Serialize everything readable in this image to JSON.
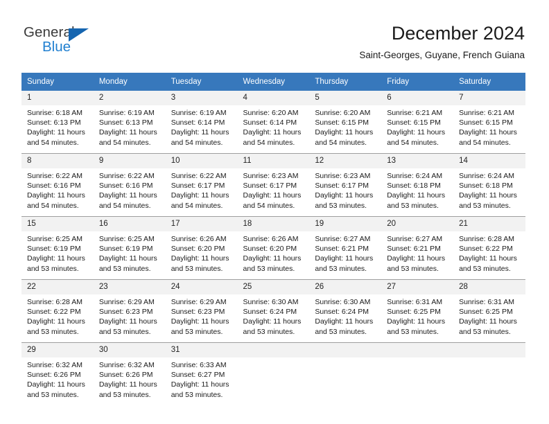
{
  "brand": {
    "name_top": "General",
    "name_bottom": "Blue",
    "triangle_color": "#1565b0",
    "blue_color": "#1f7fd0"
  },
  "header": {
    "title": "December 2024",
    "subtitle": "Saint-Georges, Guyane, French Guiana"
  },
  "theme": {
    "header_blue": "#3778bc",
    "daynum_band": "#f2f2f2",
    "row_border": "#9e9e9e"
  },
  "weekday_headers": [
    "Sunday",
    "Monday",
    "Tuesday",
    "Wednesday",
    "Thursday",
    "Friday",
    "Saturday"
  ],
  "labels": {
    "sunrise_prefix": "Sunrise:",
    "sunset_prefix": "Sunset:",
    "daylight_prefix": "Daylight:"
  },
  "weeks": [
    {
      "days": [
        {
          "date": "1",
          "sunrise": "Sunrise: 6:18 AM",
          "sunset": "Sunset: 6:13 PM",
          "daylight_l1": "Daylight: 11 hours",
          "daylight_l2": "and 54 minutes."
        },
        {
          "date": "2",
          "sunrise": "Sunrise: 6:19 AM",
          "sunset": "Sunset: 6:13 PM",
          "daylight_l1": "Daylight: 11 hours",
          "daylight_l2": "and 54 minutes."
        },
        {
          "date": "3",
          "sunrise": "Sunrise: 6:19 AM",
          "sunset": "Sunset: 6:14 PM",
          "daylight_l1": "Daylight: 11 hours",
          "daylight_l2": "and 54 minutes."
        },
        {
          "date": "4",
          "sunrise": "Sunrise: 6:20 AM",
          "sunset": "Sunset: 6:14 PM",
          "daylight_l1": "Daylight: 11 hours",
          "daylight_l2": "and 54 minutes."
        },
        {
          "date": "5",
          "sunrise": "Sunrise: 6:20 AM",
          "sunset": "Sunset: 6:15 PM",
          "daylight_l1": "Daylight: 11 hours",
          "daylight_l2": "and 54 minutes."
        },
        {
          "date": "6",
          "sunrise": "Sunrise: 6:21 AM",
          "sunset": "Sunset: 6:15 PM",
          "daylight_l1": "Daylight: 11 hours",
          "daylight_l2": "and 54 minutes."
        },
        {
          "date": "7",
          "sunrise": "Sunrise: 6:21 AM",
          "sunset": "Sunset: 6:15 PM",
          "daylight_l1": "Daylight: 11 hours",
          "daylight_l2": "and 54 minutes."
        }
      ]
    },
    {
      "days": [
        {
          "date": "8",
          "sunrise": "Sunrise: 6:22 AM",
          "sunset": "Sunset: 6:16 PM",
          "daylight_l1": "Daylight: 11 hours",
          "daylight_l2": "and 54 minutes."
        },
        {
          "date": "9",
          "sunrise": "Sunrise: 6:22 AM",
          "sunset": "Sunset: 6:16 PM",
          "daylight_l1": "Daylight: 11 hours",
          "daylight_l2": "and 54 minutes."
        },
        {
          "date": "10",
          "sunrise": "Sunrise: 6:22 AM",
          "sunset": "Sunset: 6:17 PM",
          "daylight_l1": "Daylight: 11 hours",
          "daylight_l2": "and 54 minutes."
        },
        {
          "date": "11",
          "sunrise": "Sunrise: 6:23 AM",
          "sunset": "Sunset: 6:17 PM",
          "daylight_l1": "Daylight: 11 hours",
          "daylight_l2": "and 54 minutes."
        },
        {
          "date": "12",
          "sunrise": "Sunrise: 6:23 AM",
          "sunset": "Sunset: 6:17 PM",
          "daylight_l1": "Daylight: 11 hours",
          "daylight_l2": "and 53 minutes."
        },
        {
          "date": "13",
          "sunrise": "Sunrise: 6:24 AM",
          "sunset": "Sunset: 6:18 PM",
          "daylight_l1": "Daylight: 11 hours",
          "daylight_l2": "and 53 minutes."
        },
        {
          "date": "14",
          "sunrise": "Sunrise: 6:24 AM",
          "sunset": "Sunset: 6:18 PM",
          "daylight_l1": "Daylight: 11 hours",
          "daylight_l2": "and 53 minutes."
        }
      ]
    },
    {
      "days": [
        {
          "date": "15",
          "sunrise": "Sunrise: 6:25 AM",
          "sunset": "Sunset: 6:19 PM",
          "daylight_l1": "Daylight: 11 hours",
          "daylight_l2": "and 53 minutes."
        },
        {
          "date": "16",
          "sunrise": "Sunrise: 6:25 AM",
          "sunset": "Sunset: 6:19 PM",
          "daylight_l1": "Daylight: 11 hours",
          "daylight_l2": "and 53 minutes."
        },
        {
          "date": "17",
          "sunrise": "Sunrise: 6:26 AM",
          "sunset": "Sunset: 6:20 PM",
          "daylight_l1": "Daylight: 11 hours",
          "daylight_l2": "and 53 minutes."
        },
        {
          "date": "18",
          "sunrise": "Sunrise: 6:26 AM",
          "sunset": "Sunset: 6:20 PM",
          "daylight_l1": "Daylight: 11 hours",
          "daylight_l2": "and 53 minutes."
        },
        {
          "date": "19",
          "sunrise": "Sunrise: 6:27 AM",
          "sunset": "Sunset: 6:21 PM",
          "daylight_l1": "Daylight: 11 hours",
          "daylight_l2": "and 53 minutes."
        },
        {
          "date": "20",
          "sunrise": "Sunrise: 6:27 AM",
          "sunset": "Sunset: 6:21 PM",
          "daylight_l1": "Daylight: 11 hours",
          "daylight_l2": "and 53 minutes."
        },
        {
          "date": "21",
          "sunrise": "Sunrise: 6:28 AM",
          "sunset": "Sunset: 6:22 PM",
          "daylight_l1": "Daylight: 11 hours",
          "daylight_l2": "and 53 minutes."
        }
      ]
    },
    {
      "days": [
        {
          "date": "22",
          "sunrise": "Sunrise: 6:28 AM",
          "sunset": "Sunset: 6:22 PM",
          "daylight_l1": "Daylight: 11 hours",
          "daylight_l2": "and 53 minutes."
        },
        {
          "date": "23",
          "sunrise": "Sunrise: 6:29 AM",
          "sunset": "Sunset: 6:23 PM",
          "daylight_l1": "Daylight: 11 hours",
          "daylight_l2": "and 53 minutes."
        },
        {
          "date": "24",
          "sunrise": "Sunrise: 6:29 AM",
          "sunset": "Sunset: 6:23 PM",
          "daylight_l1": "Daylight: 11 hours",
          "daylight_l2": "and 53 minutes."
        },
        {
          "date": "25",
          "sunrise": "Sunrise: 6:30 AM",
          "sunset": "Sunset: 6:24 PM",
          "daylight_l1": "Daylight: 11 hours",
          "daylight_l2": "and 53 minutes."
        },
        {
          "date": "26",
          "sunrise": "Sunrise: 6:30 AM",
          "sunset": "Sunset: 6:24 PM",
          "daylight_l1": "Daylight: 11 hours",
          "daylight_l2": "and 53 minutes."
        },
        {
          "date": "27",
          "sunrise": "Sunrise: 6:31 AM",
          "sunset": "Sunset: 6:25 PM",
          "daylight_l1": "Daylight: 11 hours",
          "daylight_l2": "and 53 minutes."
        },
        {
          "date": "28",
          "sunrise": "Sunrise: 6:31 AM",
          "sunset": "Sunset: 6:25 PM",
          "daylight_l1": "Daylight: 11 hours",
          "daylight_l2": "and 53 minutes."
        }
      ]
    },
    {
      "days": [
        {
          "date": "29",
          "sunrise": "Sunrise: 6:32 AM",
          "sunset": "Sunset: 6:26 PM",
          "daylight_l1": "Daylight: 11 hours",
          "daylight_l2": "and 53 minutes."
        },
        {
          "date": "30",
          "sunrise": "Sunrise: 6:32 AM",
          "sunset": "Sunset: 6:26 PM",
          "daylight_l1": "Daylight: 11 hours",
          "daylight_l2": "and 53 minutes."
        },
        {
          "date": "31",
          "sunrise": "Sunrise: 6:33 AM",
          "sunset": "Sunset: 6:27 PM",
          "daylight_l1": "Daylight: 11 hours",
          "daylight_l2": "and 53 minutes."
        },
        {
          "date": "",
          "sunrise": "",
          "sunset": "",
          "daylight_l1": "",
          "daylight_l2": ""
        },
        {
          "date": "",
          "sunrise": "",
          "sunset": "",
          "daylight_l1": "",
          "daylight_l2": ""
        },
        {
          "date": "",
          "sunrise": "",
          "sunset": "",
          "daylight_l1": "",
          "daylight_l2": ""
        },
        {
          "date": "",
          "sunrise": "",
          "sunset": "",
          "daylight_l1": "",
          "daylight_l2": ""
        }
      ]
    }
  ]
}
